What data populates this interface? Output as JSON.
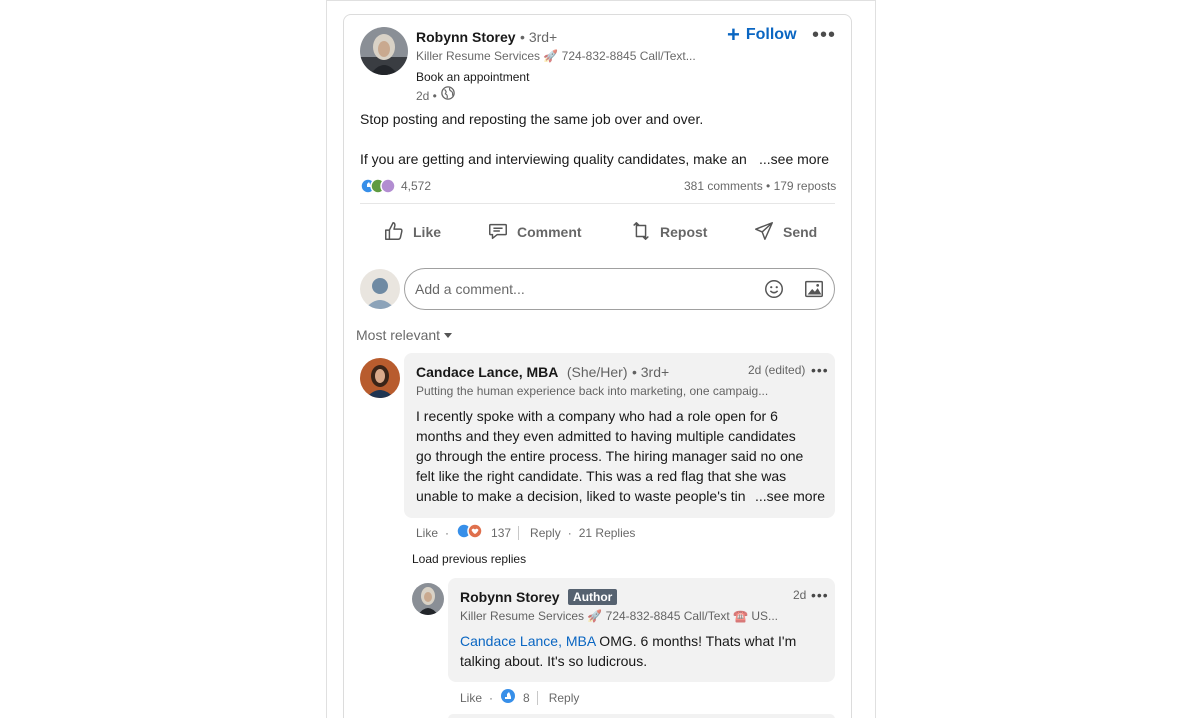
{
  "post": {
    "author_name": "Robynn Storey",
    "author_degree": "• 3rd+",
    "headline": "Killer Resume Services 🚀 724-832-8845 Call/Text...",
    "link_label": "Book an appointment",
    "time": "2d •",
    "follow_label": "Follow",
    "text_line1": "Stop posting and reposting the same job over and over.",
    "text_line2": "If you are getting and interviewing quality candidates, make an",
    "see_more": "...see more",
    "reaction_count": "4,572",
    "stats": "381 comments • 179 reposts"
  },
  "actions": {
    "like": "Like",
    "comment": "Comment",
    "repost": "Repost",
    "send": "Send"
  },
  "comment_input": {
    "placeholder": "Add a comment..."
  },
  "sort": {
    "label": "Most relevant"
  },
  "comments": [
    {
      "name": "Candace Lance, MBA",
      "pronouns": "(She/Her)",
      "degree": "• 3rd+",
      "time": "2d (edited)",
      "headline": "Putting the human experience back into marketing, one campaig...",
      "lines": [
        "I recently spoke with a company who had a role open for 6",
        "months and they even admitted to having multiple candidates",
        "go through the entire process. The hiring manager said no one",
        "felt like the right candidate. This was a red flag that she was",
        "unable to make a decision, liked to waste people's tin"
      ],
      "see_more": "...see more",
      "like": "Like",
      "reaction_count": "137",
      "reply": "Reply",
      "replies": "21 Replies"
    }
  ],
  "load_previous": "Load previous replies",
  "reply": {
    "name": "Robynn Storey",
    "badge": "Author",
    "time": "2d",
    "headline": "Killer Resume Services 🚀 724-832-8845 Call/Text ☎️ US...",
    "mention": "Candace Lance, MBA",
    "text1": " OMG. 6 months! Thats what I'm",
    "text2": "talking about. It's so ludicrous.",
    "like": "Like",
    "reaction_count": "8",
    "reply": "Reply"
  },
  "colors": {
    "link_blue": "#0a66c2",
    "bubble_bg": "#f2f2f2",
    "badge_bg": "#566270"
  }
}
